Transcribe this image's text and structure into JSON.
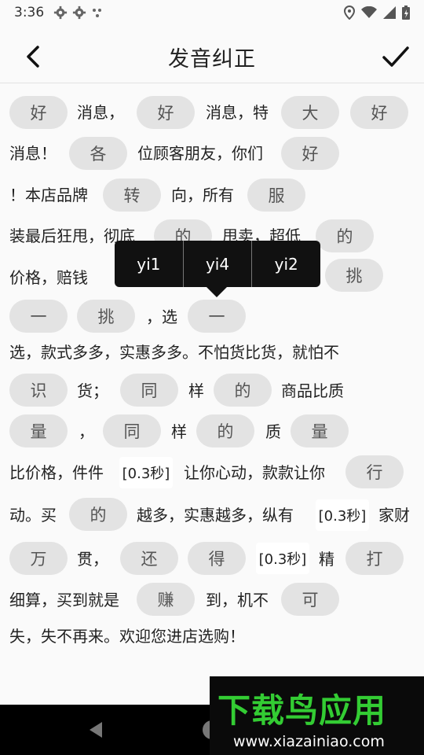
{
  "status": {
    "time": "3:36"
  },
  "app_bar": {
    "title": "发音纠正"
  },
  "passage": {
    "texts": [
      "消息，",
      "消息，特",
      "消息！",
      "位顾客朋友，你们",
      "！本店品牌",
      "向，所有",
      "装最后狂甩，彻底",
      "甩卖，超低",
      "价格，赔钱",
      "，选",
      "选，款式多多，实惠多多。不怕货比货，就怕不",
      "货；",
      "样",
      "商品比质",
      "，",
      "样",
      "质",
      "比价格，件件",
      "让你心动，款款让你",
      "动。买",
      "越多，实惠越多，纵有",
      "家财",
      "贯，",
      "精",
      "细算，买到就是",
      "到，机不",
      "失，失不再来。欢迎您进店选购！"
    ],
    "chips": [
      "好",
      "好",
      "大",
      "好",
      "各",
      "好",
      "转",
      "服",
      "的",
      "的",
      "挑",
      "一",
      "挑",
      "一",
      "识",
      "同",
      "的",
      "量",
      "同",
      "的",
      "量",
      "行",
      "的",
      "万",
      "还",
      "得",
      "打",
      "赚",
      "可"
    ],
    "pauses": [
      "[0.3秒]",
      "[0.3秒]",
      "[0.3秒]"
    ]
  },
  "pinyin_popup": {
    "options": [
      "yi1",
      "yi4",
      "yi2"
    ]
  },
  "watermark": {
    "title": "下载鸟应用",
    "url": "www.xiazainiao.com"
  },
  "colors": {
    "chip_bg": "#e3e3e3",
    "popup_bg": "#111111",
    "watermark_green": "#33cc33"
  }
}
